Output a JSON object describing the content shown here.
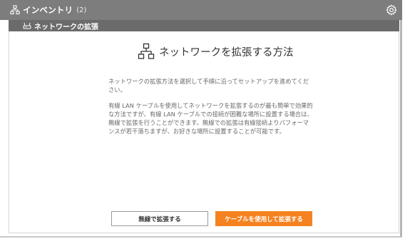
{
  "header": {
    "title": "インベントリ",
    "count": "(2)",
    "network_icon": "network-topology-icon",
    "settings_icon": "gear-icon"
  },
  "subheader": {
    "title": "ネットワークの拡張",
    "icon": "router-icon"
  },
  "main": {
    "heading": "ネットワークを拡張する方法",
    "heading_icon": "network-topology-icon",
    "paragraphs": [
      "ネットワークの拡張方法を選択して手順に沿ってセットアップを進めてください。",
      "有線 LAN ケーブルを使用してネットワークを拡張するのが最も簡単で効果的な方法ですが、有線 LAN ケーブルでの接続が困難な場所に設置する場合は、無線で拡張を行うことができます。無線での拡張は有線接続よりパフォーマンスが若干落ちますが、お好きな場所に設置することが可能です。"
    ]
  },
  "buttons": {
    "wireless_label": "無線で拡張する",
    "cable_label": "ケーブルを使用して拡張する"
  },
  "colors": {
    "accent": "#f58220",
    "header_bg": "#7d7d7d",
    "subheader_bg": "#6b6b6b"
  }
}
